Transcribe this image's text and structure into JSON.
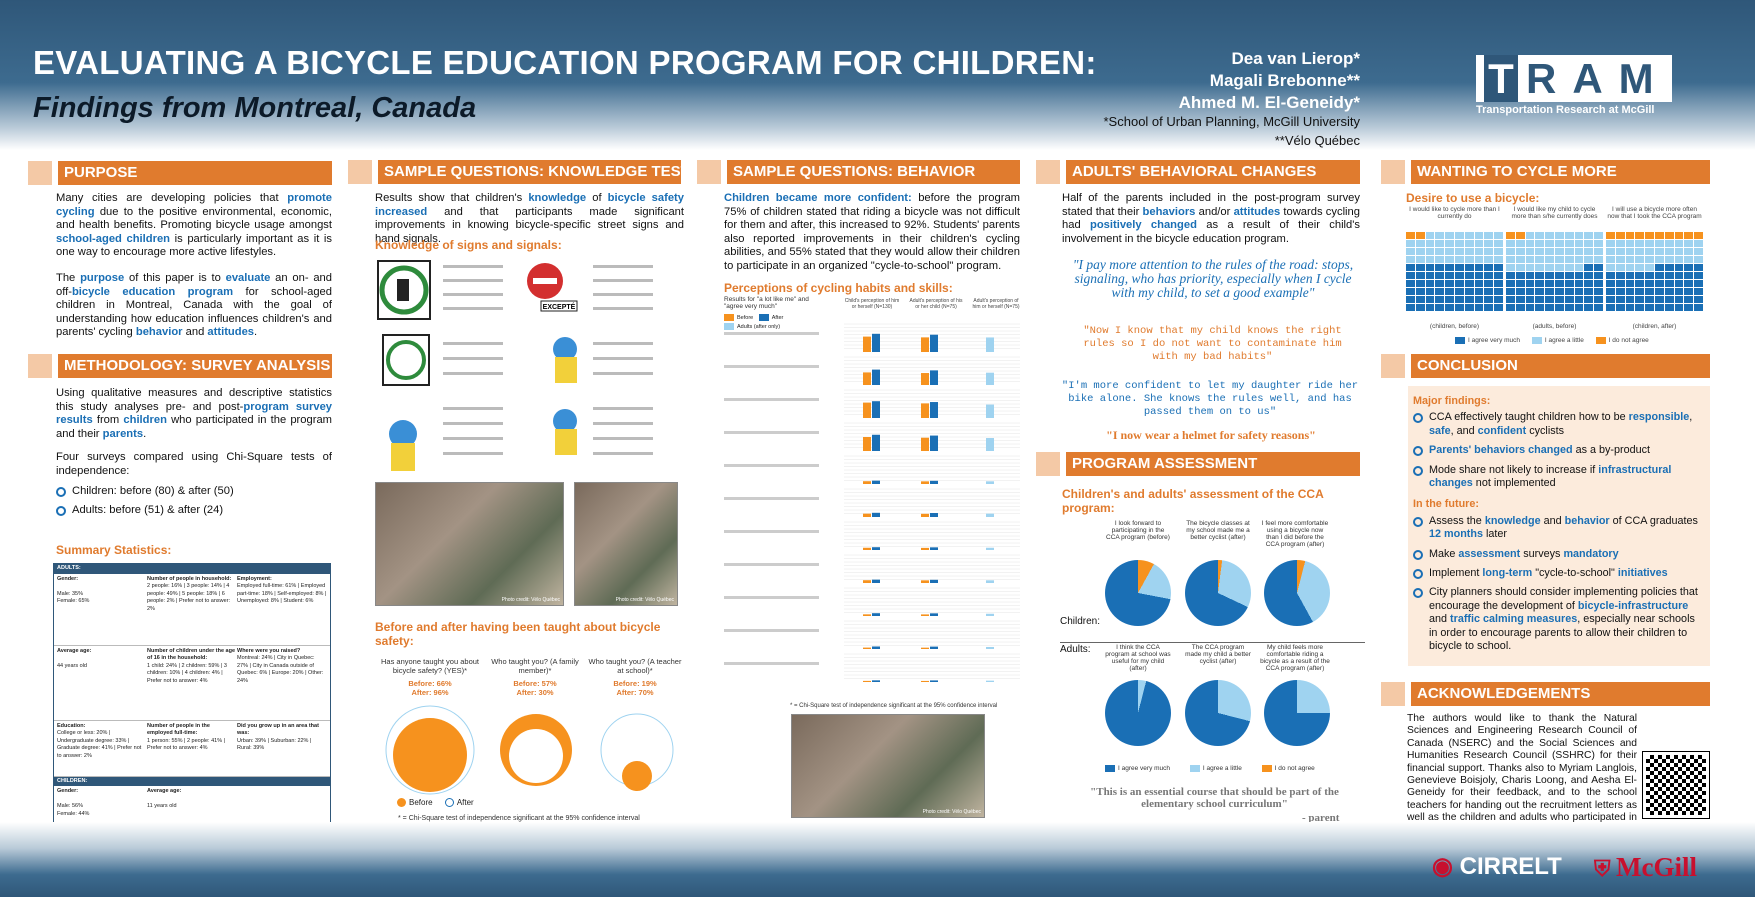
{
  "header": {
    "title": "EVALUATING A BICYCLE EDUCATION PROGRAM FOR CHILDREN:",
    "subtitle": "Findings from Montreal, Canada",
    "authors": [
      "Dea van Lierop*",
      "Magali Brebonne**",
      "Ahmed M. El-Geneidy*"
    ],
    "affiliations": [
      "*School of Urban Planning, McGill University",
      "**Vélo Québec"
    ],
    "logo_letters": "TRAM",
    "logo_sub": "Transportation Research at McGill"
  },
  "footer": {
    "cirrelt": "CIRRELT",
    "mcgill": "McGill"
  },
  "sections": {
    "purpose": "PURPOSE",
    "methodology": "METHODOLOGY: SURVEY ANALYSIS",
    "knowledge": "SAMPLE QUESTIONS: KNOWLEDGE TEST",
    "behavior": "SAMPLE QUESTIONS: BEHAVIOR",
    "adults": "ADULTS' BEHAVIORAL CHANGES",
    "assessment": "PROGRAM ASSESSMENT",
    "wanting": "WANTING TO CYCLE MORE",
    "conclusion": "CONCLUSION",
    "ack": "ACKNOWLEDGEMENTS"
  },
  "purpose": {
    "p1a": "Many cities are developing policies that ",
    "p1b": "promote cycling",
    "p1c": " due to the positive environmental, economic, and health benefits. Promoting bicycle usage amongst ",
    "p1d": "school-aged children",
    "p1e": " is particularly important as it is one way to encourage more active lifestyles.",
    "p2a": "The ",
    "p2b": "purpose",
    "p2c": " of this paper is to ",
    "p2d": "evaluate",
    "p2e": " an on- and off-",
    "p2f": "bicycle education program",
    "p2g": " for school-aged children in Montreal, Canada with the goal of understanding how education influences children's and parents' cycling ",
    "p2h": "behavior",
    "p2i": " and ",
    "p2j": "attitudes",
    "p2k": "."
  },
  "method": {
    "p1a": "Using qualitative measures and descriptive statistics this study analyses pre- and post-",
    "p1b": "program survey results",
    "p1c": " from ",
    "p1d": "children",
    "p1e": " who participated in the program and their ",
    "p1f": "parents",
    "p1g": ".",
    "p2": "Four surveys compared using Chi-Square tests of independence:",
    "b1": "Children: before (80) & after (50)",
    "b2": "Adults: before (51) & after (24)",
    "summary": "Summary Statistics:"
  },
  "stats": {
    "adults": "ADULTS:",
    "gender": "Gender:",
    "male": "Male: 35%",
    "female": "Female: 65%",
    "hh": "Number of people in household:",
    "hh_vals": "2 people: 16% | 3 people: 14% | 4 people: 49% | 5 people: 18% | 6 people: 2% | Prefer not to answer: 2%",
    "emp": "Employment:",
    "emp_vals": "Employed full-time: 61% | Employed part-time: 18% | Self-employed: 8% | Unemployed: 8% | Student: 6%",
    "age": "Average age:",
    "age_val": "44 years old",
    "kids": "Number of children under the age of 16 in the household:",
    "kids_vals": "1 child: 24% | 2 children: 59% | 3 children: 10% | 4 children: 4% | Prefer not to answer: 4%",
    "raised": "Where were you raised?",
    "raised_vals": "Montreal: 24% | City in Quebec: 27% | City in Canada outside of Quebec: 6% | Europe: 20% | Other: 24%",
    "edu": "Education:",
    "edu_vals": "College or less: 20% | Undergraduate degree: 33% | Graduate degree: 41% | Prefer not to answer: 2%",
    "ft": "Number of people in the employed full-time:",
    "ft_vals": "1 person: 55% | 2 people: 41% | Prefer not to answer: 4%",
    "area": "Did you grow up in an area that was:",
    "area_vals": "Urban: 39% | Suburban: 22% | Rural: 39%",
    "children": "CHILDREN:",
    "cgender": "Gender:",
    "cage": "Average age:",
    "cmale": "Male: 56%",
    "cfemale": "Female: 44%",
    "cage_val": "11 years old"
  },
  "knowledge": {
    "p1a": "Results show that children's ",
    "p1b": "knowledge",
    "p1c": " of ",
    "p1d": "bicycle safety increased",
    "p1e": " and that participants made significant improvements in knowing bicycle-specific street signs and hand signals.",
    "sub1": "Knowledge of signs and signals:",
    "excepte": "EXCEPTÉ",
    "sub2": "Before and after having been taught about bicycle safety:",
    "q1": "Has anyone taught you about bicycle safety? (YES)*",
    "q1b": "Before: 66%",
    "q1a": "After: 96%",
    "q2": "Who taught you? (A family member)*",
    "q2b": "Before: 57%",
    "q2a": "After: 30%",
    "q3": "Who taught you? (A teacher at school)*",
    "q3b": "Before: 19%",
    "q3a": "After: 70%",
    "legend_before": "Before",
    "legend_after": "After",
    "footnote": "* = Chi-Square test of independence significant at the 95% confidence interval",
    "photo_cap": "Photo credit: Vélo Québec"
  },
  "behavior": {
    "p1a": "Children became more confident:",
    "p1b": " before the program 75% of children stated that riding a bicycle was not difficult for them and after, this increased to 92%. Students' parents also reported improvements in their children's cycling abilities, and 55% stated that they would allow their children to participate in an organized \"cycle-to-school\" program.",
    "sub": "Perceptions of cycling habits and skills:",
    "results_for": "Results for \"a lot like me\" and \"agree very much\"",
    "leg_before": "Before",
    "leg_after": "After",
    "leg_adults": "Adults (after only)",
    "col1": "Child's perception of him or herself (N=130)",
    "col2": "Adult's perception of his or her child (N=75)",
    "col3": "Adult's perception of him or herself (N=75)",
    "footnote": "* = Chi-Square test of independence significant at the 95% confidence interval"
  },
  "adults": {
    "p1a": "Half of the parents included in the post-program survey stated that their ",
    "p1b": "behaviors",
    "p1c": " and/or ",
    "p1d": "attitudes",
    "p1e": " towards cycling had ",
    "p1f": "positively changed",
    "p1g": " as a result of their child's involvement in the bicycle education program.",
    "q1": "\"I pay more attention to the rules of the road: stops, signaling, who has priority, especially when I cycle with my child, to set a good example\"",
    "q2": "\"Now I know that my child knows the right rules so I do not want to contaminate him with my bad habits\"",
    "q3": "\"I'm more confident to let my daughter ride her bike alone. She knows the rules well, and has passed them on to us\"",
    "q4": "\"I now wear a helmet for safety reasons\""
  },
  "assessment": {
    "sub": "Children's and adults' assessment of the CCA program:",
    "children": "Children:",
    "adults": "Adults:",
    "c1": "I look forward to participating in the CCA program (before)",
    "c2": "The bicycle classes at my school made me a better cyclist (after)",
    "c3": "I feel more comfortable using a bicycle now than I did before the CCA program (after)",
    "a1": "I think the CCA program at school was useful for my child (after)",
    "a2": "The CCA program made my child a better cyclist (after)",
    "a3": "My child feels more comfortable riding a bicycle as a result of the CCA program (after)",
    "l1": "I agree very much",
    "l2": "I agree a little",
    "l3": "I do not agree",
    "quote": "\"This is an essential course that should be part of the elementary school curriculum\"",
    "by": "- parent"
  },
  "wanting": {
    "sub": "Desire to use a bicycle:",
    "c1": "I would like to cycle more than I currently do",
    "c2": "I would like my child to cycle more than s/he currently does",
    "c3": "I will use a bicycle more often now that I took the CCA program",
    "x1": "(children, before)",
    "x2": "(adults, before)",
    "x3": "(children, after)",
    "l1": "I agree very much",
    "l2": "I agree a little",
    "l3": "I do not agree"
  },
  "conclusion": {
    "major": "Major findings:",
    "m1a": "CCA effectively taught children how to be ",
    "m1b": "responsible",
    "m1c": ", ",
    "m1d": "safe",
    "m1e": ", and ",
    "m1f": "confident",
    "m1g": " cyclists",
    "m2a": "Parents' behaviors changed",
    "m2b": " as a by-product",
    "m3a": "Mode share not likely to increase if ",
    "m3b": "infrastructural changes",
    "m3c": " not implemented",
    "future": "In the future:",
    "f1a": "Assess the ",
    "f1b": "knowledge",
    "f1c": " and ",
    "f1d": "behavior",
    "f1e": " of CCA graduates ",
    "f1f": "12 months",
    "f1g": " later",
    "f2a": "Make ",
    "f2b": "assessment",
    "f2c": " surveys ",
    "f2d": "mandatory",
    "f3a": "Implement ",
    "f3b": "long-term",
    "f3c": " \"cycle-to-school\" ",
    "f3d": "initiatives",
    "f4a": "City planners should consider implementing policies that encourage the development of ",
    "f4b": "bicycle-infrastructure",
    "f4c": " and ",
    "f4d": "traffic calming measures",
    "f4e": ", especially near schools in order to encourage parents to allow their children to bicycle to school."
  },
  "ack": {
    "text": "The authors would like to thank the Natural Sciences and Engineering Research Council of Canada (NSERC) and the Social Sciences and Humanities Research Council (SSHRC) for their financial support. Thanks also to Myriam Langlois, Genevieve Boisjoly, Charis Loong, and Aesha El-Geneidy for their feedback, and to the school teachers for handing out the recruitment letters as well as the children and adults who participated in the surveys."
  },
  "colors": {
    "orange": "#e07b2e",
    "blue": "#1a6fb5",
    "navy": "#2f5779",
    "light_blue": "#9fd3f0"
  }
}
